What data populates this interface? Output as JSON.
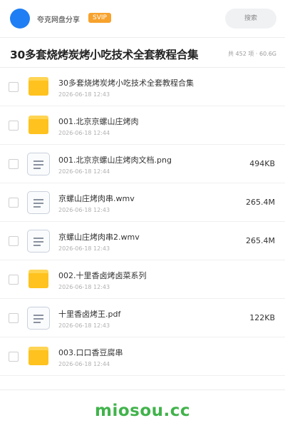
{
  "header": {
    "brand_name": "夸克网盘分享",
    "badge": "SVIP",
    "search_label": "搜索"
  },
  "folder": {
    "title": "30多套烧烤炭烤小吃技术全套教程合集",
    "meta": "共 452 项 · 60.6G"
  },
  "files": [
    {
      "name": "30多套烧烤炭烤小吃技术全套教程合集",
      "date": "2026-06-18 12:43",
      "size": "",
      "icon": "folder-icon"
    },
    {
      "name": "001.北京京螺山庄烤肉",
      "date": "2026-06-18 12:44",
      "size": "",
      "icon": "folder-icon"
    },
    {
      "name": "001.北京京螺山庄烤肉文档.png",
      "date": "2026-06-18 12:44",
      "size": "494KB",
      "icon": "file-icon"
    },
    {
      "name": "京螺山庄烤肉串.wmv",
      "date": "2026-06-18 12:43",
      "size": "265.4M",
      "icon": "file-icon"
    },
    {
      "name": "京螺山庄烤肉串2.wmv",
      "date": "2026-06-18 12:43",
      "size": "265.4M",
      "icon": "file-icon"
    },
    {
      "name": "002.十里香卤烤卤菜系列",
      "date": "2026-06-18 12:43",
      "size": "",
      "icon": "folder-icon"
    },
    {
      "name": "十里香卤烤王.pdf",
      "date": "2026-06-18 12:43",
      "size": "122KB",
      "icon": "file-icon"
    },
    {
      "name": "003.口口香豆腐串",
      "date": "2026-06-18 12:44",
      "size": "",
      "icon": "folder-icon"
    }
  ],
  "footer": {
    "wordmark": "miosou.cc"
  },
  "colors": {
    "accent_blue": "#1f7ef3",
    "svip_orange": "#f7a22d",
    "folder_yellow": "#ffc21e",
    "wordmark_green": "#41b34b"
  }
}
